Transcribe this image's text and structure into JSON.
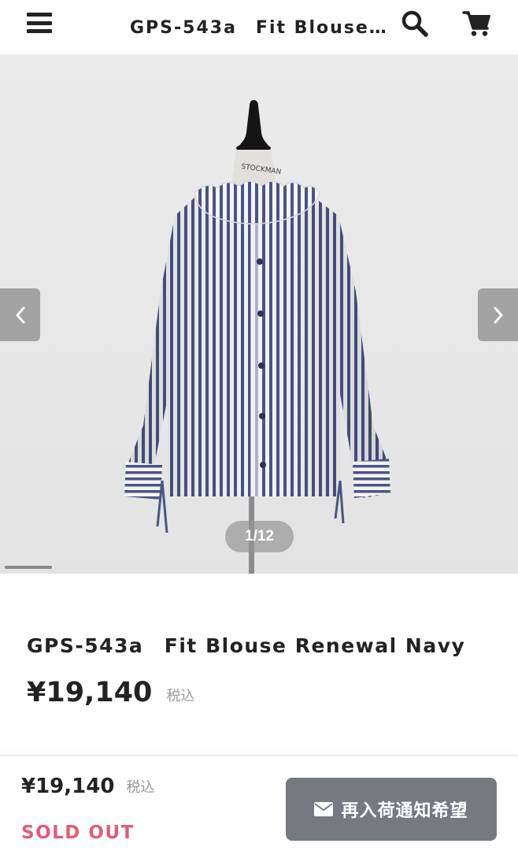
{
  "header": {
    "title": "GPS-543a　Fit Blouse Renewal Navy",
    "menu_icon": "hamburger-menu-icon",
    "search_icon": "search-icon",
    "cart_icon": "cart-icon"
  },
  "gallery": {
    "counter": "1/12",
    "current_index": 1,
    "total": 12,
    "mannequin_tag": "STOCKMAN"
  },
  "product": {
    "name": "GPS-543a　Fit Blouse Renewal Navy",
    "price": "¥19,140",
    "tax_label": "税込"
  },
  "bottom_bar": {
    "price": "¥19,140",
    "tax_label": "税込",
    "status": "SOLD OUT",
    "restock_button_label": "再入荷通知希望",
    "restock_icon": "envelope-icon"
  },
  "colors": {
    "sold_out": "#e05d76",
    "button_bg": "#767a80",
    "text": "#222222"
  }
}
